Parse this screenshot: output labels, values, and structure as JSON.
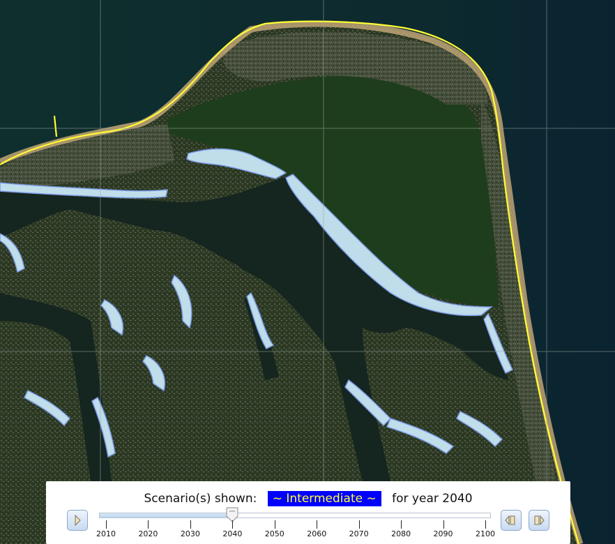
{
  "map": {
    "type": "satellite-imagery-with-sea-level-rise-overlay",
    "colors": {
      "water": "#0f2c2e",
      "deep_water": "#0b2430",
      "land_forest": "#1f3f1c",
      "land_urban": "#5a6050",
      "beach": "#c9ab7a",
      "inundation": "#c8e6f5",
      "inundation_edge": "#7f9ff0",
      "shoreline": "#ffff33",
      "grid": "#9aa5a0"
    }
  },
  "controls": {
    "caption_prefix": "Scenario(s) shown:",
    "scenario_label": "~ Intermediate ~",
    "caption_suffix": "for year 2040",
    "scenario_bg": "#0000ff",
    "scenario_fg": "#ffff33",
    "play_button": "play-icon",
    "prev_button": "step-back-icon",
    "next_button": "step-forward-icon",
    "slider": {
      "min": 2010,
      "max": 2100,
      "value": 2040,
      "ticks": [
        "2010",
        "2020",
        "2030",
        "2040",
        "2050",
        "2060",
        "2070",
        "2080",
        "2090",
        "2100"
      ]
    }
  }
}
